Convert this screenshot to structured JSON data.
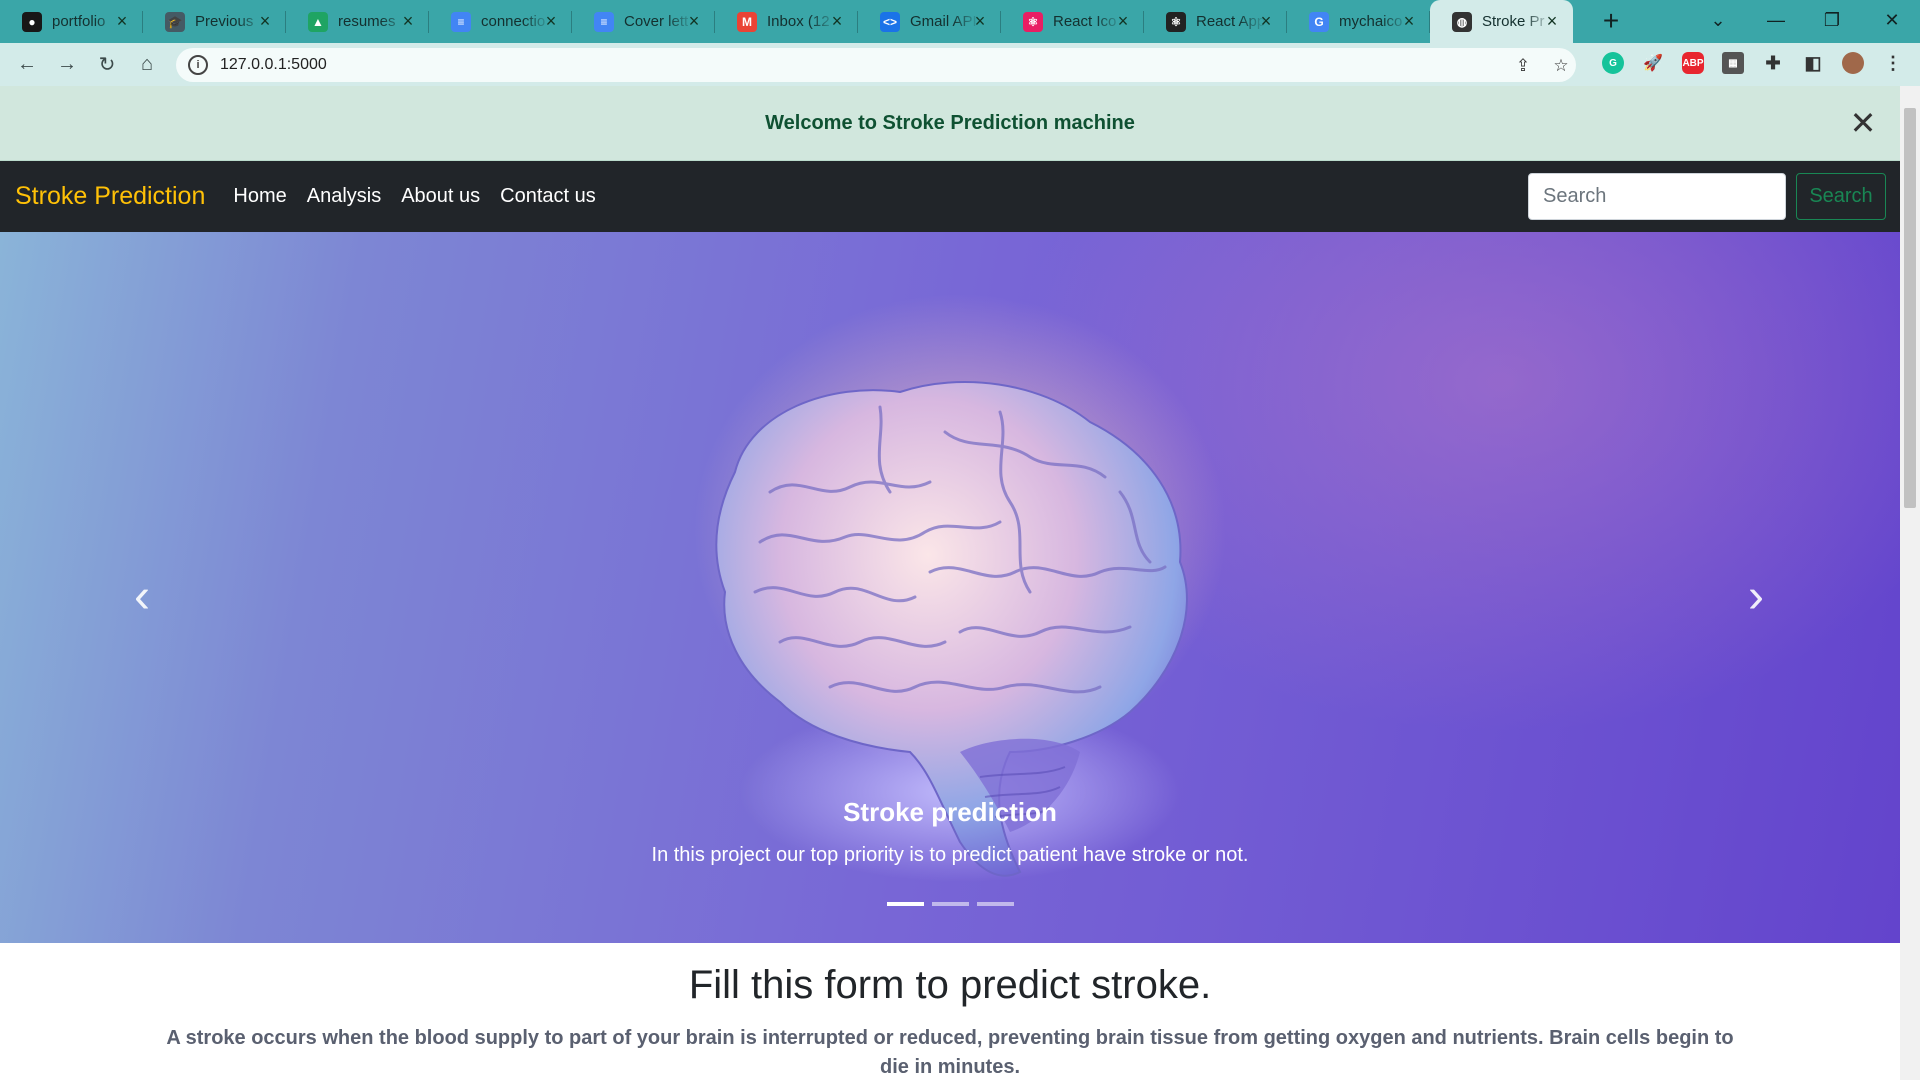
{
  "browser": {
    "tabs": [
      {
        "title": "portfolio",
        "icon": "github-icon",
        "color": "#181717"
      },
      {
        "title": "Previous",
        "icon": "graduation-cap-icon",
        "color": "#455a64"
      },
      {
        "title": "resumes",
        "icon": "google-drive-icon",
        "color": "#1fa463"
      },
      {
        "title": "connectio",
        "icon": "google-docs-icon",
        "color": "#4285f4"
      },
      {
        "title": "Cover lett",
        "icon": "google-docs-icon",
        "color": "#4285f4"
      },
      {
        "title": "Inbox (12",
        "icon": "gmail-icon",
        "color": "#ea4335"
      },
      {
        "title": "Gmail API",
        "icon": "code-icon",
        "color": "#1a73e8"
      },
      {
        "title": "React Ico",
        "icon": "react-icon",
        "color": "#e91e63"
      },
      {
        "title": "React App",
        "icon": "react-icon",
        "color": "#222222"
      },
      {
        "title": "mychaico",
        "icon": "google-icon",
        "color": "#4285f4"
      },
      {
        "title": "Stroke Pr",
        "icon": "globe-icon",
        "color": "#333333"
      }
    ],
    "url": "127.0.0.1:5000",
    "theme_color": "#3aa6a8"
  },
  "alert": {
    "text": "Welcome to Stroke Prediction machine",
    "close": "✕"
  },
  "navbar": {
    "brand": "Stroke Prediction",
    "links": [
      "Home",
      "Analysis",
      "About us",
      "Contact us"
    ],
    "search_placeholder": "Search",
    "search_button": "Search",
    "brand_color": "#ffc107"
  },
  "carousel": {
    "caption_title": "Stroke prediction",
    "caption_text": "In this project our top priority is to predict patient have stroke or not.",
    "slides": 3,
    "active_slide": 1,
    "prev": "‹",
    "next": "›"
  },
  "form_section": {
    "title": "Fill this form to predict stroke.",
    "description": "A stroke occurs when the blood supply to part of your brain is interrupted or reduced, preventing brain tissue from getting oxygen and nutrients. Brain cells begin to die in minutes."
  }
}
